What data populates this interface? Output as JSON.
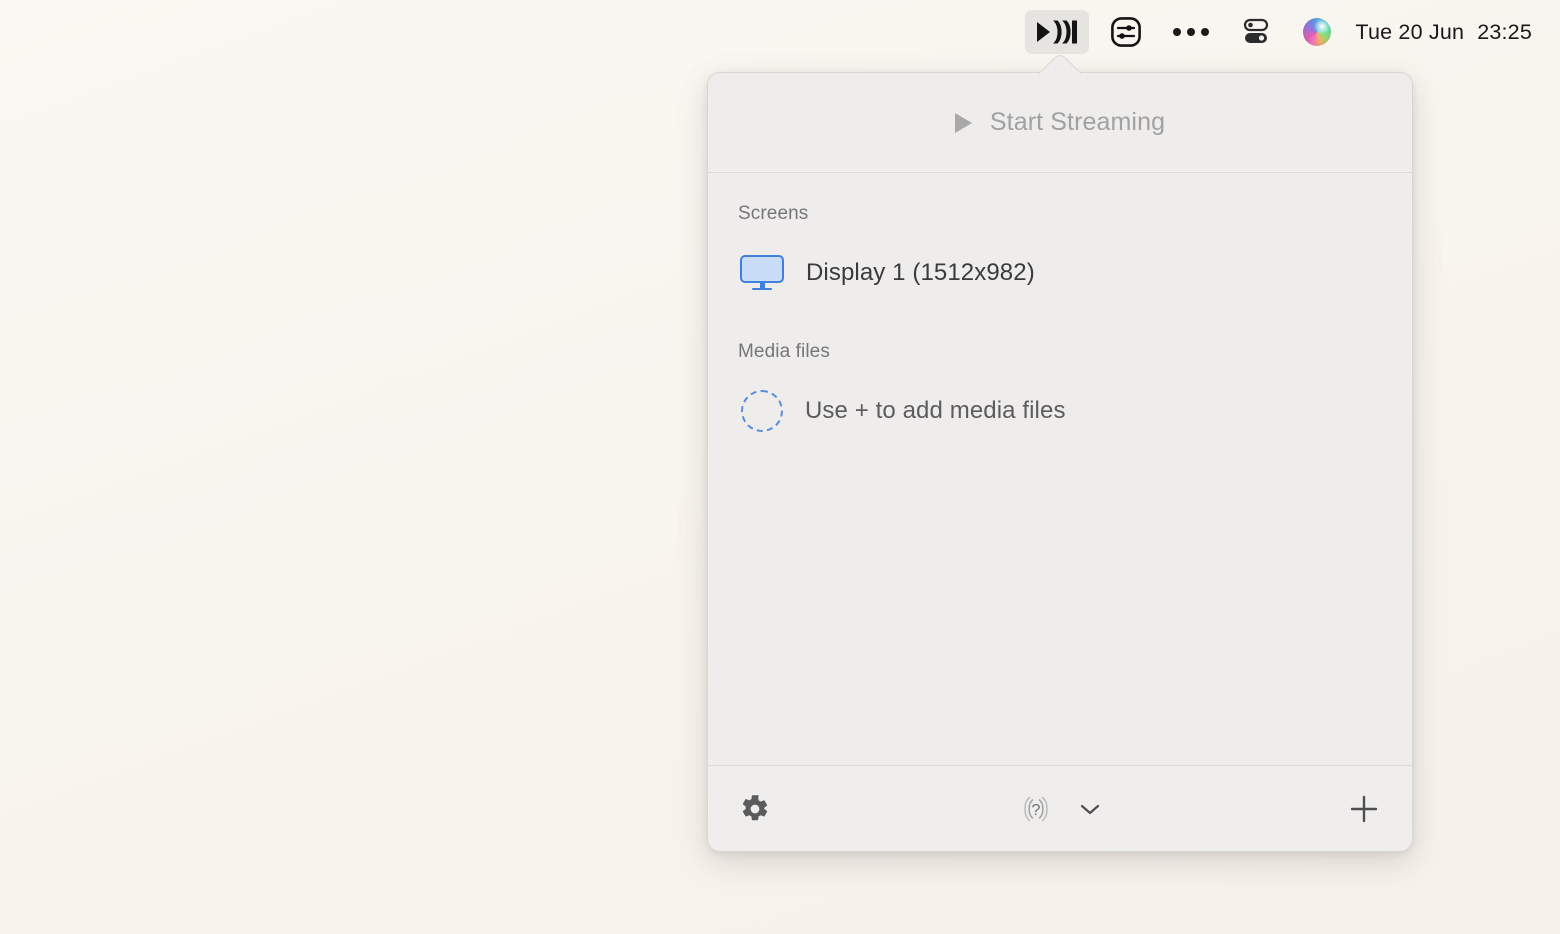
{
  "menubar": {
    "items": [
      {
        "name": "streaming-menu-icon",
        "icon": "airplay-stream-icon",
        "active": true
      },
      {
        "name": "sliders-menu-icon",
        "icon": "sliders-icon",
        "active": false
      },
      {
        "name": "more-menu-icon",
        "icon": "ellipsis-icon",
        "active": false
      },
      {
        "name": "control-center-icon",
        "icon": "control-center-icon",
        "active": false
      },
      {
        "name": "siri-icon",
        "icon": "siri-orb-icon",
        "active": false
      }
    ],
    "clock": {
      "date": "Tue 20 Jun",
      "time": "23:25"
    }
  },
  "popover": {
    "header": {
      "label": "Start Streaming",
      "icon": "play-icon",
      "enabled": false
    },
    "sections": [
      {
        "title": "Screens",
        "items": [
          {
            "label": "Display 1 (1512x982)",
            "icon": "display-icon"
          }
        ]
      },
      {
        "title": "Media files",
        "items": [
          {
            "label": "Use + to add media files",
            "icon": "add-media-placeholder-icon"
          }
        ]
      }
    ],
    "footer": {
      "settings_icon": "gear-icon",
      "help_icon": "help-broadcast-icon",
      "help_chevron_icon": "chevron-down-icon",
      "add_icon": "plus-icon"
    }
  },
  "colors": {
    "desktop": "#faf6f1",
    "panel": "#eeedec",
    "accent_blue": "#3f7fe0",
    "disabled_text": "#a1a1a1",
    "section_title": "#77767a"
  }
}
